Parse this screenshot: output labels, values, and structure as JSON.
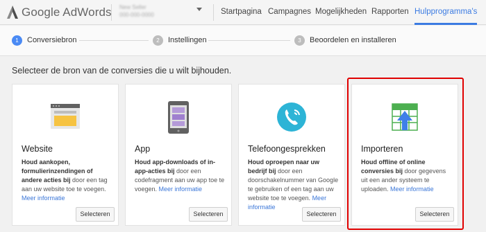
{
  "header": {
    "logo_text": "Google AdWords",
    "account_name": "New Seller",
    "account_id": "000-000-0000",
    "nav": [
      {
        "label": "Startpagina"
      },
      {
        "label": "Campagnes"
      },
      {
        "label": "Mogelijkheden"
      },
      {
        "label": "Rapporten"
      },
      {
        "label": "Hulpprogramma's",
        "active": true
      }
    ]
  },
  "steps": [
    {
      "num": "1",
      "label": "Conversiebron",
      "active": true
    },
    {
      "num": "2",
      "label": "Instellingen"
    },
    {
      "num": "3",
      "label": "Beoordelen en installeren"
    }
  ],
  "heading": "Selecteer de bron van de conversies die u wilt bijhouden.",
  "cards": [
    {
      "title": "Website",
      "icon": "website-icon",
      "desc_bold": "Houd aankopen, formulierinzendingen of andere acties bij",
      "desc_rest": " door een tag aan uw website toe te voegen. ",
      "link": "Meer informatie",
      "button": "Selecteren"
    },
    {
      "title": "App",
      "icon": "mobile-app-icon",
      "desc_bold": "Houd app-downloads of in-app-acties bij",
      "desc_rest": " door een codefragment aan uw app toe te voegen. ",
      "link": "Meer informatie",
      "button": "Selecteren"
    },
    {
      "title": "Telefoongesprekken",
      "icon": "phone-icon",
      "desc_bold": "Houd oproepen naar uw bedrijf bij",
      "desc_rest": " door een doorschakelnummer van Google te gebruiken of een tag aan uw website toe te voegen. ",
      "link": "Meer informatie",
      "button": "Selecteren"
    },
    {
      "title": "Importeren",
      "icon": "import-icon",
      "desc_bold": "Houd offline of online conversies bij",
      "desc_rest": " door gegevens uit een ander systeem te uploaden. ",
      "link": "Meer informatie",
      "button": "Selecteren"
    }
  ],
  "colors": {
    "accent": "#4a8af4",
    "highlight": "#e00000",
    "link": "#3a76d8"
  }
}
